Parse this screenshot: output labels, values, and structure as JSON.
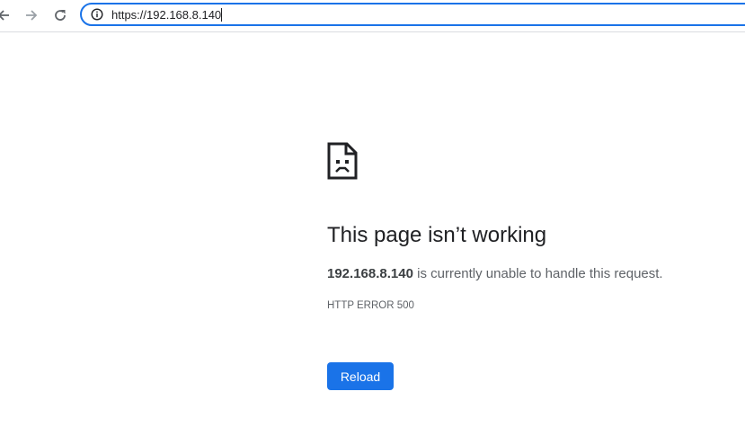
{
  "browser": {
    "back_icon": "arrow-left-icon",
    "forward_icon": "arrow-right-icon",
    "reload_icon": "reload-icon",
    "address_bar": {
      "security_icon": "info-icon",
      "url": "https://192.168.8.140"
    }
  },
  "error_page": {
    "icon": "sad-page-icon",
    "headline": "This page isn’t working",
    "host": "192.168.8.140",
    "description_suffix": " is currently unable to handle this request.",
    "error_code": "HTTP ERROR 500",
    "reload_label": "Reload"
  },
  "colors": {
    "accent": "#1a73e8",
    "text_primary": "#202124",
    "text_secondary": "#5f6368"
  }
}
